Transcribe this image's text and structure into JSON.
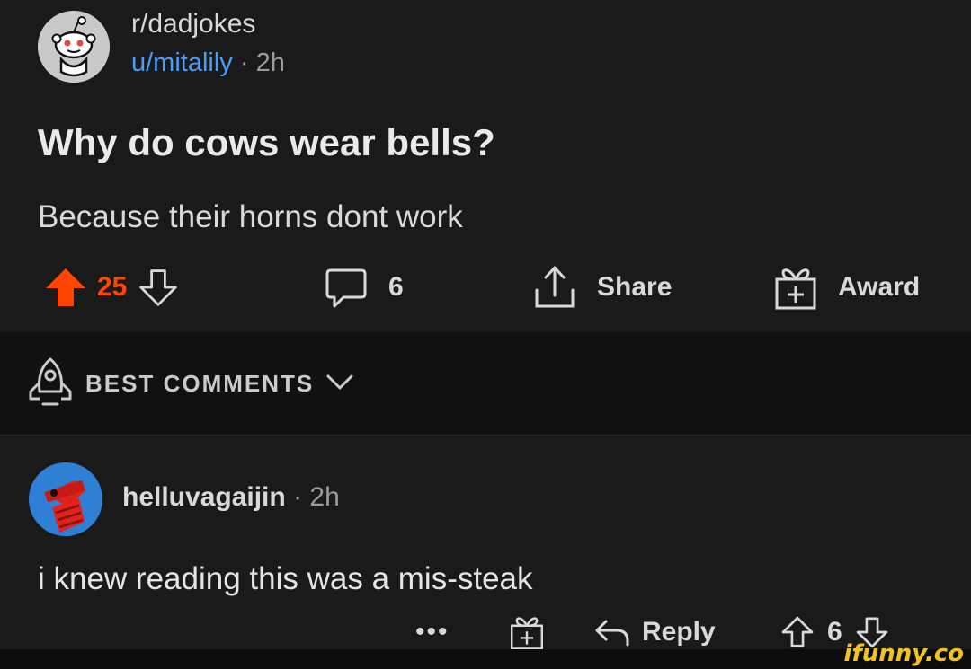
{
  "post": {
    "subreddit": "r/dadjokes",
    "author": "u/mitalily",
    "separator": "·",
    "age": "2h",
    "title": "Why do cows wear bells?",
    "body": "Because their horns dont work",
    "upvotes": "25",
    "comments": "6",
    "share_label": "Share",
    "award_label": "Award"
  },
  "sort": {
    "label": "BEST COMMENTS"
  },
  "comment": {
    "author": "helluvagaijin",
    "separator": "·",
    "age": "2h",
    "body": "i knew reading this was a mis-steak",
    "more": "•••",
    "reply_label": "Reply",
    "score": "6"
  },
  "watermark": "ifunny.co",
  "colors": {
    "background": "#1a1a1b",
    "upvote_active": "#ff4500",
    "username_link": "#4d9cf8",
    "watermark": "#f4c21b"
  }
}
